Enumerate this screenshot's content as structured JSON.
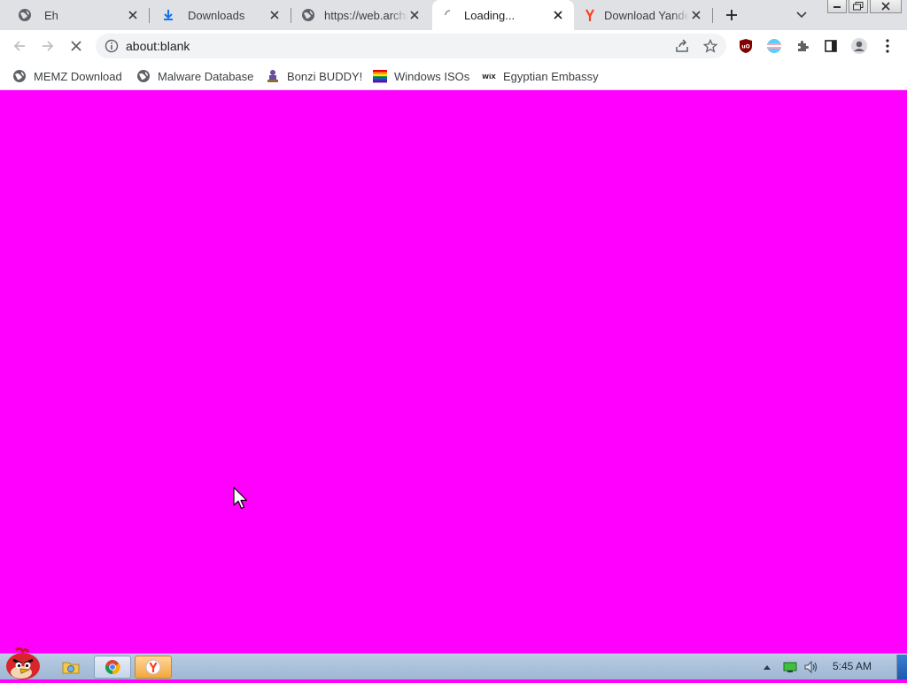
{
  "browser": {
    "tabs": [
      {
        "title": "Eh",
        "icon": "globe-icon",
        "active": false
      },
      {
        "title": "Downloads",
        "icon": "download-icon",
        "active": false
      },
      {
        "title": "https://web.archive.org",
        "icon": "globe-icon",
        "active": false
      },
      {
        "title": "Loading...",
        "icon": "loading-spinner-icon",
        "active": true
      },
      {
        "title": "Download Yandex",
        "icon": "yandex-icon",
        "active": false
      }
    ],
    "address": {
      "url": "about:blank"
    },
    "bookmarks": [
      {
        "label": "MEMZ Download",
        "icon": "globe-icon"
      },
      {
        "label": "Malware Database",
        "icon": "globe-icon"
      },
      {
        "label": "Bonzi BUDDY!",
        "icon": "bonzi-icon"
      },
      {
        "label": "Windows ISOs",
        "icon": "rainbow-icon"
      },
      {
        "label": "Egyptian Embassy",
        "icon": "wix-icon"
      }
    ]
  },
  "page": {
    "background_color": "#ff00ff"
  },
  "taskbar": {
    "items": [
      {
        "name": "start-orb",
        "icon": "angry-bird-icon"
      },
      {
        "name": "explorer",
        "icon": "folder-icon"
      },
      {
        "name": "chrome",
        "icon": "chrome-icon"
      },
      {
        "name": "yandex",
        "icon": "yandex-icon"
      }
    ],
    "clock": "5:45 AM"
  },
  "colors": {
    "tabstrip": "#dfe1e5",
    "accent_blue": "#1a73e8",
    "yandex_red": "#fc3f1d",
    "ublock_red": "#800000",
    "taskbar": "#b9cde3"
  }
}
